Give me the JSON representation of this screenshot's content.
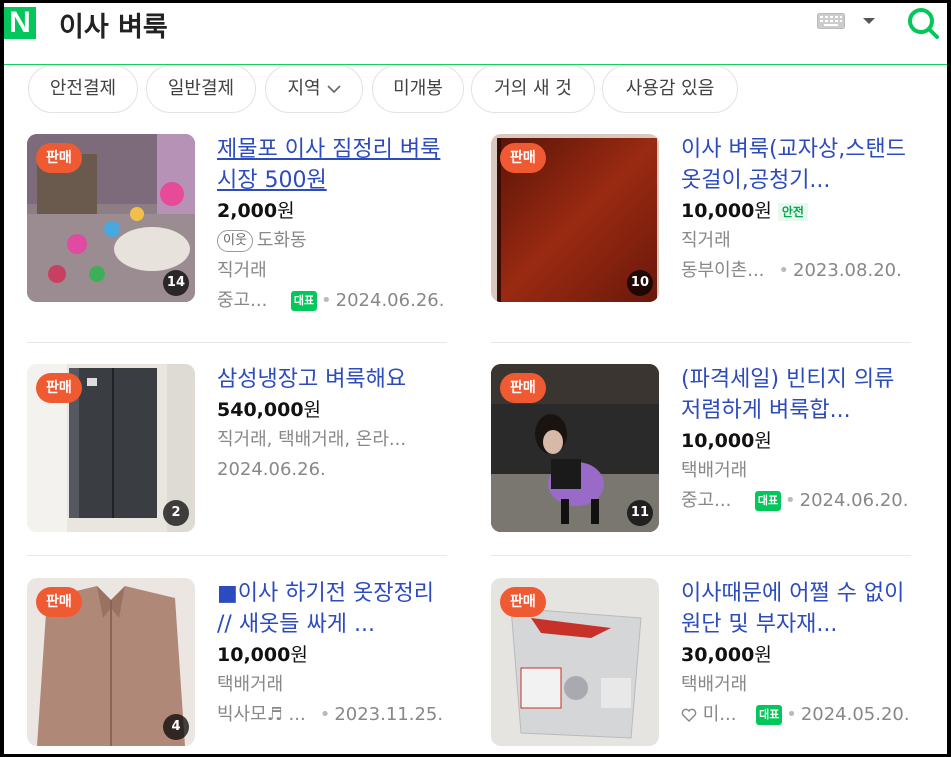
{
  "header": {
    "logo": "N",
    "query": "이사 벼룩"
  },
  "icons": {
    "keyboard": "keyboard-icon",
    "dropdown": "caret-down-icon",
    "search": "search-icon"
  },
  "chips": [
    {
      "label": "안전결제"
    },
    {
      "label": "일반결제"
    },
    {
      "label": "지역"
    },
    {
      "label": "미개봉"
    },
    {
      "label": "거의 새 것"
    },
    {
      "label": "사용감 있음"
    }
  ],
  "items": [
    {
      "badge": "판매",
      "count": "14",
      "title": "제물포 이사 짐정리 벼룩시장 500원",
      "price": "2,000",
      "won": "원",
      "neighbor_tag": "이웃",
      "neighbor_name": "도화동",
      "line1": "직거래",
      "seller": "중고...",
      "rep": "대표",
      "date": "2024.06.26."
    },
    {
      "badge": "판매",
      "count": "10",
      "title": "이사 벼룩(교자상,스탠드옷걸이,공청기...",
      "price": "10,000",
      "won": "원",
      "safe": "안전",
      "line1": "직거래",
      "seller": "동부이촌...",
      "date": "2023.08.20."
    },
    {
      "badge": "판매",
      "count": "2",
      "title": "삼성냉장고 벼룩해요",
      "price": "540,000",
      "won": "원",
      "line1": "직거래, 택배거래, 온라...",
      "date": "2024.06.26."
    },
    {
      "badge": "판매",
      "count": "11",
      "title": "(파격세일) 빈티지 의류 저렴하게 벼룩합...",
      "price": "10,000",
      "won": "원",
      "line1": "택배거래",
      "seller": "중고...",
      "rep": "대표",
      "date": "2024.06.20."
    },
    {
      "badge": "판매",
      "count": "4",
      "title": "■이사 하기전 옷장정리 // 새옷들 싸게 ...",
      "price": "10,000",
      "won": "원",
      "line1": "택배거래",
      "seller": "빅사모♬ ...",
      "date": "2023.11.25."
    },
    {
      "badge": "판매",
      "count": "",
      "title": "이사때문에 어쩔 수 없이 원단 및 부자재...",
      "price": "30,000",
      "won": "원",
      "line1": "택배거래",
      "seller": "미...",
      "rep": "대표",
      "date": "2024.05.20."
    }
  ],
  "colors": {
    "brand": "#03c75a",
    "link": "#2c4bbf",
    "sale_badge": "#f05a33"
  }
}
